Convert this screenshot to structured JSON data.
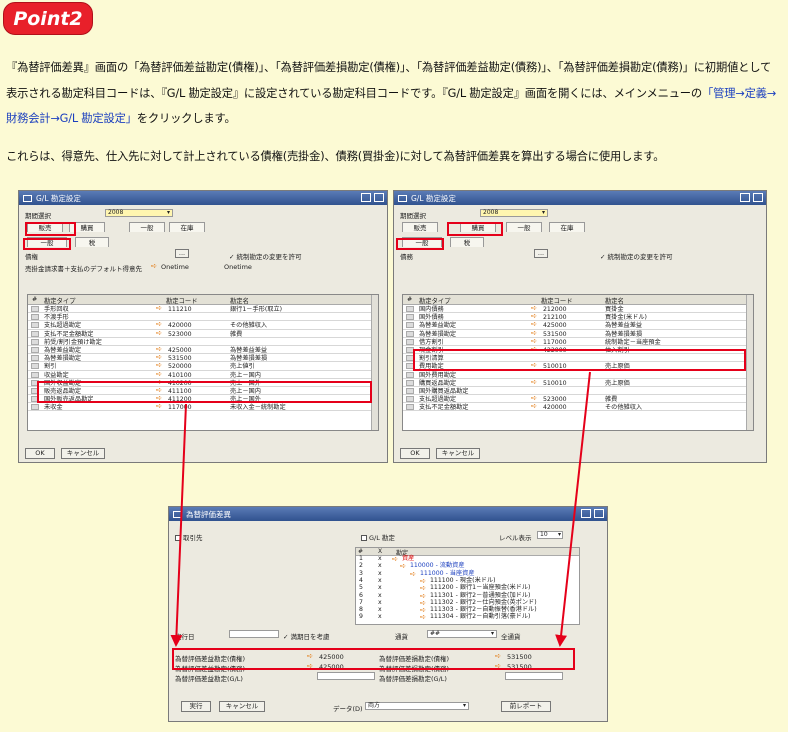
{
  "badge": "Point2",
  "paragraph1": {
    "part1": "『為替評価差異』画面の「為替評価差益勘定(債権)」、「為替評価差損勘定(債権)」、「為替評価差益勘定(債務)」、「為替評価差損勘定(債務)」に初期値として表示される勘定科目コードは、『G/L 勘定設定』に設定されている勘定科目コードです。『G/L 勘定設定』画面を開くには、メインメニューの",
    "highlight": "「管理→定義→財務会計→G/L 勘定設定」",
    "part3": "をクリックします。"
  },
  "paragraph2": "これらは、得意先、仕入先に対して計上されている債権(売掛金)、債務(買掛金)に対して為替評価差異を算出する場合に使用します。",
  "left_window": {
    "title": "G/L 勘定設定",
    "period_label": "期間選択",
    "period_value": "2008",
    "tabs": [
      "販売",
      "購買",
      "一般",
      "在庫"
    ],
    "subtabs": [
      "一般",
      "税"
    ],
    "mgmt_label": "債権",
    "acct_btn": "...",
    "check_label": "✓ 統制勘定の変更を許可",
    "line2_label": "売掛金請求書＋支払のデフォルト得意先",
    "line2_code": "Onetime",
    "line2_name": "Onetime",
    "col_type": "勘定タイプ",
    "col_code": "勘定コード",
    "col_name": "勘定名",
    "rows": [
      {
        "type": "手形回収",
        "code": "111210",
        "name": "銀行1－手形(取立)"
      },
      {
        "type": "不渡手形",
        "code": "",
        "name": ""
      },
      {
        "type": "支払超過勘定",
        "code": "420000",
        "name": "その他雑収入"
      },
      {
        "type": "支払不足金額勘定",
        "code": "523000",
        "name": "雑費"
      },
      {
        "type": "前受/割引金預け勘定",
        "code": "",
        "name": ""
      },
      {
        "type": "為替差益勘定",
        "code": "425000",
        "name": "為替差益差益"
      },
      {
        "type": "為替差損勘定",
        "code": "531500",
        "name": "為替差損差損"
      },
      {
        "type": "割引",
        "code": "520000",
        "name": "売上値引"
      },
      {
        "type": "収益勘定",
        "code": "410100",
        "name": "売上－国内"
      },
      {
        "type": "国外収益勘定",
        "code": "410200",
        "name": "売上－国外"
      },
      {
        "type": "販売返品勘定",
        "code": "411100",
        "name": "売上－国内"
      },
      {
        "type": "国外販売返品勘定",
        "code": "411200",
        "name": "売上－国外"
      },
      {
        "type": "未収金",
        "code": "117000",
        "name": "未収入金－統制勘定"
      }
    ],
    "ok": "OK",
    "cancel": "キャンセル"
  },
  "right_window": {
    "title": "G/L 勘定設定",
    "period_label": "期間選択",
    "period_value": "2008",
    "tabs": [
      "販売",
      "購買",
      "一般",
      "在庫"
    ],
    "subtabs": [
      "一般",
      "税"
    ],
    "mgmt_label": "債務",
    "acct_btn": "...",
    "check_label": "✓ 統制勘定の変更を許可",
    "col_type": "勘定タイプ",
    "col_code": "勘定コード",
    "col_name": "勘定名",
    "rows": [
      {
        "type": "国内債務",
        "code": "212000",
        "name": "買掛金"
      },
      {
        "type": "国外債務",
        "code": "212100",
        "name": "買掛金(米ドル)"
      },
      {
        "type": "為替差益勘定",
        "code": "425000",
        "name": "為替差益差益"
      },
      {
        "type": "為替差損勘定",
        "code": "531500",
        "name": "為替差損差損"
      },
      {
        "type": "借方割引",
        "code": "117000",
        "name": "統制勘定－当座預金"
      },
      {
        "type": "現金割引",
        "code": "422000",
        "name": "仕入割引"
      },
      {
        "type": "割引清算",
        "code": "",
        "name": ""
      },
      {
        "type": "費用勘定",
        "code": "510010",
        "name": "売上原価"
      },
      {
        "type": "国外費用勘定",
        "code": "",
        "name": ""
      },
      {
        "type": "購買返品勘定",
        "code": "510010",
        "name": "売上原価"
      },
      {
        "type": "国外購買返品勘定",
        "code": "",
        "name": ""
      },
      {
        "type": "支払超過勘定",
        "code": "523000",
        "name": "雑費"
      },
      {
        "type": "支払不足金額勘定",
        "code": "420000",
        "name": "その他雑収入"
      }
    ],
    "ok": "OK",
    "cancel": "キャンセル"
  },
  "bottom_window": {
    "title": "為替評価差異",
    "supplier_chk": "取引先",
    "gl_chk": "G/L 勘定",
    "level_label": "レベル表示",
    "level_value": "10",
    "col_hash": "#",
    "col_x": "X",
    "col_acct": "勘定",
    "tree": [
      {
        "n": "1",
        "x": "x",
        "label": "資産"
      },
      {
        "n": "2",
        "x": "x",
        "label": "110000 - 流動資産"
      },
      {
        "n": "3",
        "x": "x",
        "label": "111000 - 当座資産"
      },
      {
        "n": "4",
        "x": "x",
        "label": "111100 - 現金(米ドル)"
      },
      {
        "n": "5",
        "x": "x",
        "label": "111200 - 銀行1－当座預金(米ドル)"
      },
      {
        "n": "6",
        "x": "x",
        "label": "111301 - 銀行2－普通預金(加ドル)"
      },
      {
        "n": "7",
        "x": "x",
        "label": "111302 - 銀行2－仕向預金(英ポンド)"
      },
      {
        "n": "8",
        "x": "x",
        "label": "111303 - 銀行2－自動振替(香港ドル)"
      },
      {
        "n": "9",
        "x": "x",
        "label": "111304 - 銀行2－自動引落(豪ドル)"
      }
    ],
    "exec_date_label": "実行日",
    "consider_due": "✓ 満期日を考慮",
    "currency_label": "通貨",
    "currency_value": "##",
    "all_currency": "全通貨",
    "r1_label": "為替評価差益勘定(債権)",
    "r1_code": "425000",
    "r1b_label": "為替評価差損勘定(債権)",
    "r1b_code": "531500",
    "r2_label": "為替評価差益勘定(債務)",
    "r2_code": "425000",
    "r2b_label": "為替評価差損勘定(債務)",
    "r2b_code": "531500",
    "r3_label": "為替評価差益勘定(G/L)",
    "r3b_label": "為替評価差損勘定(G/L)",
    "exec_btn": "実行",
    "cancel_btn": "キャンセル",
    "data_label": "データ(D)",
    "data_value": "両方",
    "report_btn": "前レポート"
  },
  "colors": {
    "badge": "#e8202a",
    "background": "#fcfad4",
    "highlight": "#e5001a",
    "link_text": "#1b3fbf"
  }
}
